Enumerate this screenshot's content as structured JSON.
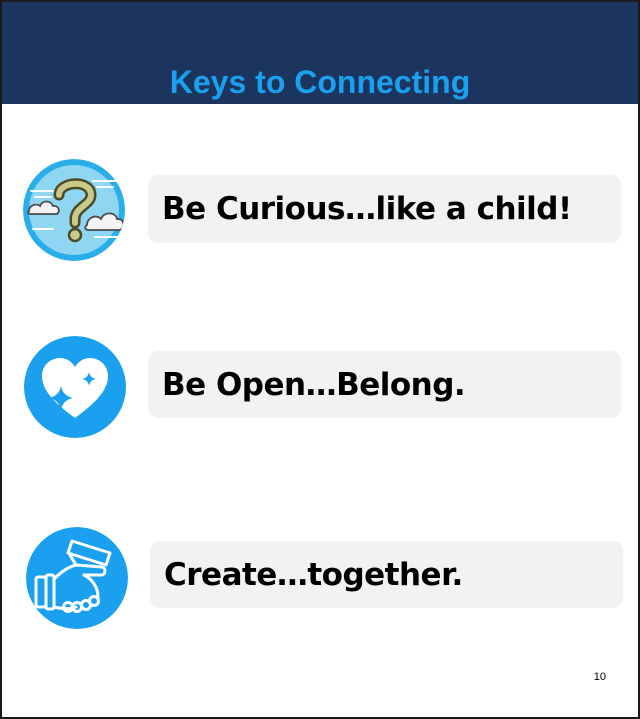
{
  "slide": {
    "title": "Keys to Connecting",
    "page_number": "10",
    "colors": {
      "header_background": "#1c355e",
      "title_text": "#1aa0ee",
      "icon_circle": "#1aa0ee",
      "key_box_background": "#f2f2f2"
    },
    "keys": [
      {
        "icon": "curiosity-question-clouds-icon",
        "text": "Be Curious…like a child!"
      },
      {
        "icon": "heart-sparkle-icon",
        "text": "Be Open…Belong."
      },
      {
        "icon": "handshake-icon",
        "text": "Create…together."
      }
    ]
  }
}
